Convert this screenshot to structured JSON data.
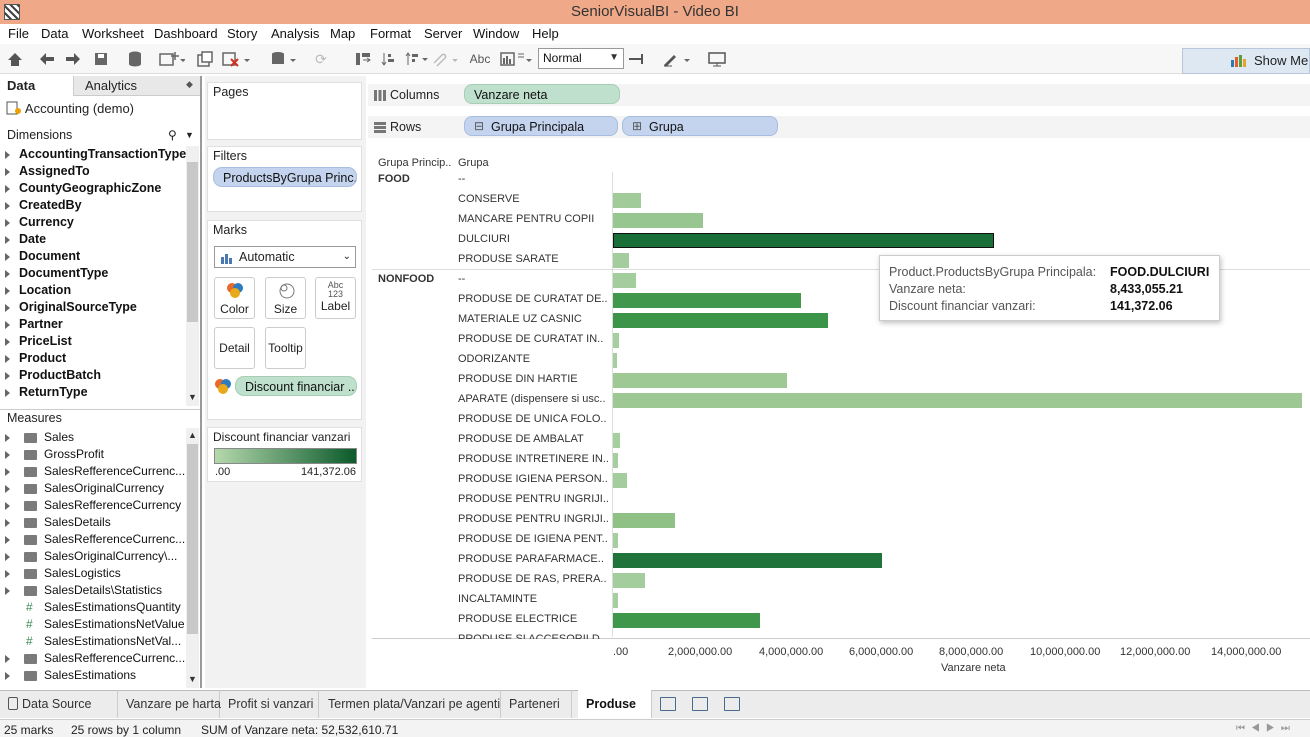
{
  "window": {
    "title": "SeniorVisualBI - Video BI"
  },
  "menu": [
    "File",
    "Data",
    "Worksheet",
    "Dashboard",
    "Story",
    "Analysis",
    "Map",
    "Format",
    "Server",
    "Window",
    "Help"
  ],
  "toolbar": {
    "fit_select": "Normal",
    "abc_label": "Abc",
    "show_me_label": "Show Me"
  },
  "left_panel": {
    "tabs": {
      "data": "Data",
      "analytics": "Analytics"
    },
    "datasource": "Accounting (demo)",
    "dimensions_header": "Dimensions",
    "dimensions": [
      "AccountingTransactionType",
      "AssignedTo",
      "CountyGeographicZone",
      "CreatedBy",
      "Currency",
      "Date",
      "Document",
      "DocumentType",
      "Location",
      "OriginalSourceType",
      "Partner",
      "PriceList",
      "Product",
      "ProductBatch",
      "ReturnType"
    ],
    "measures_header": "Measures",
    "measures": [
      {
        "name": "Sales",
        "kind": "folder"
      },
      {
        "name": "GrossProfit",
        "kind": "folder"
      },
      {
        "name": "SalesRefferenceCurrenc...",
        "kind": "folder"
      },
      {
        "name": "SalesOriginalCurrency",
        "kind": "folder"
      },
      {
        "name": "SalesRefferenceCurrency",
        "kind": "folder"
      },
      {
        "name": "SalesDetails",
        "kind": "folder"
      },
      {
        "name": "SalesRefferenceCurrenc...",
        "kind": "folder"
      },
      {
        "name": "SalesOriginalCurrency\\...",
        "kind": "folder"
      },
      {
        "name": "SalesLogistics",
        "kind": "folder"
      },
      {
        "name": "SalesDetails\\Statistics",
        "kind": "folder"
      },
      {
        "name": "SalesEstimationsQuantity",
        "kind": "measure"
      },
      {
        "name": "SalesEstimationsNetValue",
        "kind": "measure"
      },
      {
        "name": "SalesEstimationsNetVal...",
        "kind": "measure"
      },
      {
        "name": "SalesRefferenceCurrenc...",
        "kind": "folder"
      },
      {
        "name": "SalesEstimations",
        "kind": "folder"
      }
    ]
  },
  "cards": {
    "pages": "Pages",
    "filters": "Filters",
    "filter_pill": "ProductsByGrupa Princ..",
    "marks": "Marks",
    "mark_type": "Automatic",
    "mark_buttons": {
      "color": "Color",
      "size": "Size",
      "label": "Label",
      "detail": "Detail",
      "tooltip": "Tooltip",
      "label_icon": "Abc\n123"
    },
    "color_pill": "Discount financiar ..",
    "legend_title": "Discount financiar vanzari",
    "legend_min": ".00",
    "legend_max": "141,372.06"
  },
  "shelves": {
    "columns_label": "Columns",
    "columns_pill": "Vanzare neta",
    "rows_label": "Rows",
    "rows_pills": [
      "Grupa Principala",
      "Grupa"
    ]
  },
  "chart_data": {
    "type": "bar",
    "orientation": "horizontal",
    "row_headers": [
      "Grupa Princip..",
      "Grupa"
    ],
    "xlabel": "Vanzare neta",
    "xlim": [
      0,
      15300000
    ],
    "x_ticks": [
      ".00",
      "2,000,000.00",
      "4,000,000.00",
      "6,000,000.00",
      "8,000,000.00",
      "10,000,000.00",
      "12,000,000.00",
      "14,000,000.00"
    ],
    "color_legend": "Discount financiar vanzari",
    "groups": [
      {
        "name": "FOOD",
        "rows": [
          {
            "category": "--",
            "value": 0,
            "color": "#a5cf9e"
          },
          {
            "category": "CONSERVE",
            "value": 620000,
            "color": "#a1cb99"
          },
          {
            "category": "MANCARE PENTRU COPII",
            "value": 1980000,
            "color": "#98c690"
          },
          {
            "category": "DULCIURI",
            "value": 8433055.21,
            "color": "#1a6f38"
          },
          {
            "category": "PRODUSE SARATE",
            "value": 360000,
            "color": "#a3cd9c"
          }
        ]
      },
      {
        "name": "NONFOOD",
        "rows": [
          {
            "category": "--",
            "value": 500000,
            "color": "#a3cd9c"
          },
          {
            "category": "PRODUSE DE CURATAT DE..",
            "value": 4150000,
            "color": "#41984d"
          },
          {
            "category": "MATERIALE UZ CASNIC",
            "value": 4750000,
            "color": "#3c9449"
          },
          {
            "category": "PRODUSE DE CURATAT IN..",
            "value": 130000,
            "color": "#a6cf9f"
          },
          {
            "category": "ODORIZANTE",
            "value": 90000,
            "color": "#a6cf9f"
          },
          {
            "category": "PRODUSE DIN HARTIE",
            "value": 3850000,
            "color": "#9ec995"
          },
          {
            "category": "APARATE (dispensere si usc..",
            "value": 15250000,
            "color": "#9dc894"
          },
          {
            "category": "PRODUSE DE UNICA FOLO..",
            "value": 0,
            "color": "#a6cf9f"
          },
          {
            "category": "PRODUSE DE AMBALAT",
            "value": 150000,
            "color": "#a6cf9f"
          },
          {
            "category": "PRODUSE INTRETINERE IN..",
            "value": 110000,
            "color": "#a6cf9f"
          },
          {
            "category": "PRODUSE IGIENA PERSON..",
            "value": 310000,
            "color": "#a3cd9c"
          },
          {
            "category": "PRODUSE PENTRU INGRIJI..",
            "value": 0,
            "color": "#a6cf9f"
          },
          {
            "category": "PRODUSE PENTRU INGRIJI..",
            "value": 1380000,
            "color": "#8fc187"
          },
          {
            "category": "PRODUSE DE IGIENA PENT..",
            "value": 110000,
            "color": "#a6cf9f"
          },
          {
            "category": "PRODUSE PARAFARMACE..",
            "value": 5950000,
            "color": "#1f733b"
          },
          {
            "category": "PRODUSE DE RAS, PRERA..",
            "value": 700000,
            "color": "#a3cd9c"
          },
          {
            "category": "INCALTAMINTE",
            "value": 110000,
            "color": "#a6cf9f"
          },
          {
            "category": "PRODUSE ELECTRICE",
            "value": 3250000,
            "color": "#3f974c"
          },
          {
            "category": "PRODUSE SI ACCESORII D..",
            "value": 0,
            "color": "#a6cf9f"
          }
        ]
      }
    ]
  },
  "tooltip": {
    "rows": [
      {
        "key": "Product.ProductsByGrupa Principala:",
        "value": "FOOD.DULCIURI"
      },
      {
        "key": "Vanzare neta:",
        "value": "8,433,055.21"
      },
      {
        "key": "Discount financiar vanzari:",
        "value": "141,372.06"
      }
    ]
  },
  "sheet_tabs": [
    "Data Source",
    "Vanzare pe harta",
    "Profit si vanzari",
    "Termen plata/Vanzari pe agenti",
    "Parteneri",
    "Produse"
  ],
  "active_tab": "Produse",
  "status": {
    "marks": "25 marks",
    "rows": "25 rows by 1 column",
    "sum": "SUM of Vanzare neta: 52,532,610.71"
  }
}
